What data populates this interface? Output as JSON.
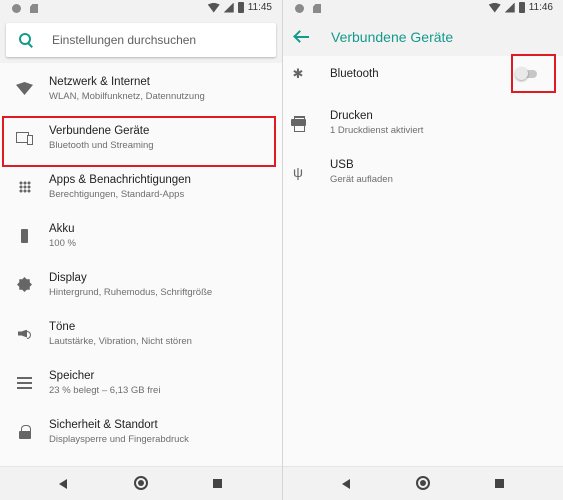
{
  "left": {
    "status_bar": {
      "time": "11:45"
    },
    "search": {
      "placeholder": "Einstellungen durchsuchen"
    },
    "items": [
      {
        "title": "Netzwerk & Internet",
        "subtitle": "WLAN, Mobilfunknetz, Datennutzung",
        "icon": "wifi-icon"
      },
      {
        "title": "Verbundene Geräte",
        "subtitle": "Bluetooth und Streaming",
        "icon": "devices-icon"
      },
      {
        "title": "Apps & Benachrichtigungen",
        "subtitle": "Berechtigungen, Standard-Apps",
        "icon": "apps-icon"
      },
      {
        "title": "Akku",
        "subtitle": "100 %",
        "icon": "battery-icon"
      },
      {
        "title": "Display",
        "subtitle": "Hintergrund, Ruhemodus, Schriftgröße",
        "icon": "display-icon"
      },
      {
        "title": "Töne",
        "subtitle": "Lautstärke, Vibration, Nicht stören",
        "icon": "sound-icon"
      },
      {
        "title": "Speicher",
        "subtitle": "23 % belegt – 6,13 GB frei",
        "icon": "storage-icon"
      },
      {
        "title": "Sicherheit & Standort",
        "subtitle": "Displaysperre und Fingerabdruck",
        "icon": "lock-icon"
      }
    ]
  },
  "right": {
    "status_bar": {
      "time": "11:46"
    },
    "app_bar": {
      "title": "Verbundene Geräte"
    },
    "items": [
      {
        "title": "Bluetooth",
        "subtitle": "",
        "icon": "bluetooth-icon",
        "toggle": false
      },
      {
        "title": "Drucken",
        "subtitle": "1 Druckdienst aktiviert",
        "icon": "printer-icon"
      },
      {
        "title": "USB",
        "subtitle": "Gerät aufladen",
        "icon": "usb-icon"
      }
    ]
  },
  "colors": {
    "accent": "#159a8c",
    "highlight": "#e01a22"
  }
}
